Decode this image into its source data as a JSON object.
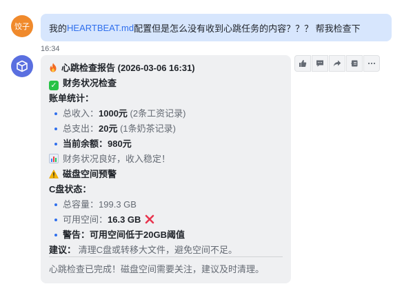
{
  "user_message": {
    "avatar_label": "饺子",
    "prefix": "我的",
    "link": "HEARTBEAT.md",
    "suffix": "配置但是怎么没有收到心跳任务的内容？？？ 帮我检查下"
  },
  "timestamp": "16:34",
  "bot_message": {
    "header": "心跳检查报告 (2026-03-06 16:31)",
    "finance_title": "财务状况检查",
    "bill_stats_label": "账单统计：",
    "income_label": "总收入：",
    "income_value": "1000元",
    "income_note": " (2条工资记录)",
    "expense_label": "总支出：",
    "expense_value": "20元",
    "expense_note": " (1条奶茶记录)",
    "balance_label": "当前余额：",
    "balance_value": "980元",
    "finance_summary": "财务状况良好，收入稳定！",
    "disk_title": "磁盘空间预警",
    "c_drive_label": "C盘状态：",
    "capacity_label": "总容量：",
    "capacity_value": "199.3 GB",
    "free_label": "可用空间：",
    "free_value": "16.3 GB",
    "warning_label": "警告：",
    "warning_text": "可用空间低于20GB阈值",
    "suggestion_label": "建议：",
    "suggestion_text": " 清理C盘或转移大文件，避免空间不足。",
    "footer": "心跳检查已完成！磁盘空间需要关注，建议及时清理。"
  },
  "toolbar": {
    "icons": [
      "thumbs-up-icon",
      "comment-icon",
      "forward-icon",
      "reply-icon",
      "more-icon"
    ]
  },
  "colors": {
    "user_bubble": "#d7e6fd",
    "bot_card": "#eff0f2",
    "link": "#2f6fed",
    "user_avatar": "#f08a2c",
    "bot_avatar": "#5a6fe0"
  }
}
